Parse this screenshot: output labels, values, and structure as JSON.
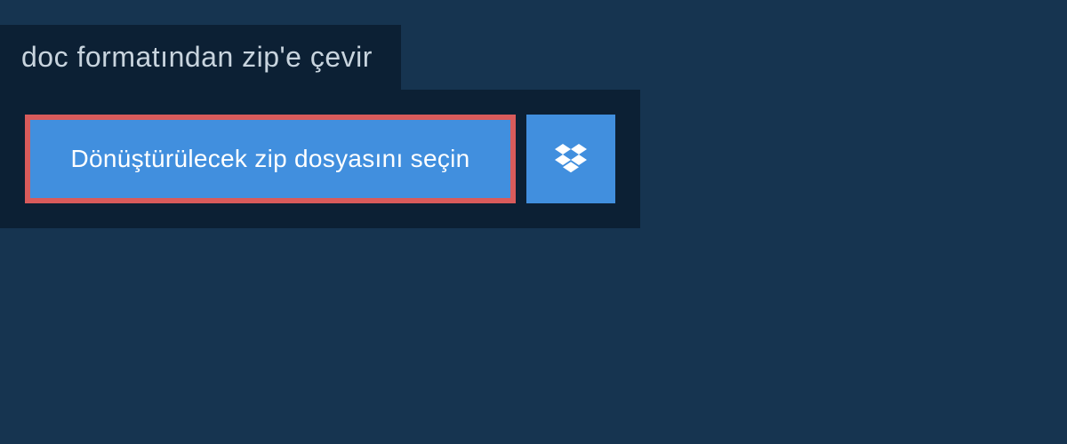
{
  "header": {
    "title": "doc formatından zip'e çevir"
  },
  "actions": {
    "select_file_label": "Dönüştürülecek zip dosyasını seçin"
  },
  "colors": {
    "background": "#163450",
    "panel": "#0c2034",
    "button_primary": "#418fde",
    "highlight_border": "#d95b5b"
  }
}
